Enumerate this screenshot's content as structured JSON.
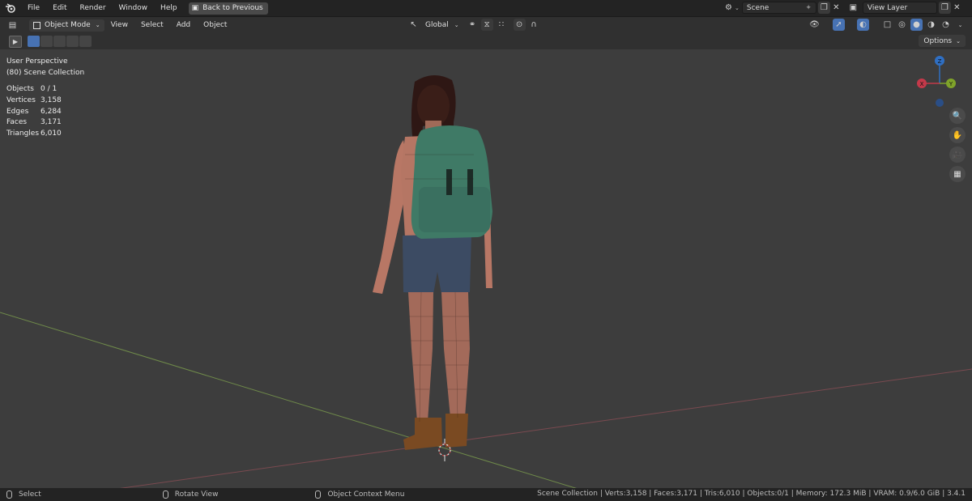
{
  "topbar": {
    "menus": [
      "File",
      "Edit",
      "Render",
      "Window",
      "Help"
    ],
    "back_button": "Back to Previous",
    "scene_name": "Scene",
    "view_layer": "View Layer"
  },
  "viewport_header": {
    "mode": "Object Mode",
    "menus": [
      "View",
      "Select",
      "Add",
      "Object"
    ],
    "transform_orientation": "Global"
  },
  "tool_row": {
    "options_label": "Options"
  },
  "viewport": {
    "perspective_label": "User Perspective",
    "collection_label": "(80) Scene Collection",
    "stats": [
      {
        "label": "Objects",
        "value": "0 / 1"
      },
      {
        "label": "Vertices",
        "value": "3,158"
      },
      {
        "label": "Edges",
        "value": "6,284"
      },
      {
        "label": "Faces",
        "value": "3,171"
      },
      {
        "label": "Triangles",
        "value": "6,010"
      }
    ],
    "gizmo": {
      "z": "Z",
      "x": "X",
      "y": "Y"
    },
    "colors": {
      "background": "#3d3d3d",
      "x_axis": "#c4394a",
      "y_axis": "#7fa32a",
      "z_axis": "#2f6fc3"
    }
  },
  "statusbar": {
    "select": "Select",
    "rotate": "Rotate View",
    "context": "Object Context Menu",
    "info": "Scene Collection | Verts:3,158 | Faces:3,171 | Tris:6,010 | Objects:0/1 | Memory: 172.3 MiB | VRAM: 0.9/6.0 GiB | 3.4.1"
  }
}
